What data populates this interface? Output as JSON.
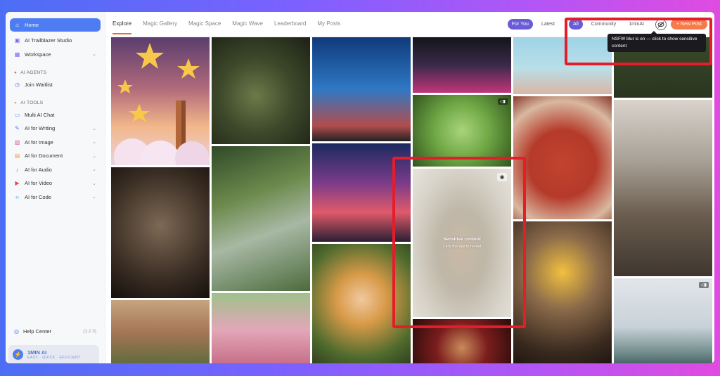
{
  "sidebar": {
    "items": [
      {
        "label": "Home",
        "icon": "home-icon",
        "glyph": "⌂"
      },
      {
        "label": "AI Trailblazer Studio",
        "icon": "studio-icon",
        "glyph": "▣"
      },
      {
        "label": "Workspace",
        "icon": "workspace-icon",
        "glyph": "▦"
      }
    ],
    "sections": {
      "agents": "AI AGENTS",
      "tools": "AI TOOLS"
    },
    "agent_items": [
      {
        "label": "Join Waitlist",
        "icon": "clock-icon",
        "glyph": "◷"
      }
    ],
    "tool_items": [
      {
        "label": "Multi AI Chat",
        "icon": "chat-icon",
        "glyph": "▭"
      },
      {
        "label": "AI for Writing",
        "icon": "writing-icon",
        "glyph": "✎"
      },
      {
        "label": "AI for Image",
        "icon": "image-icon",
        "glyph": "▨"
      },
      {
        "label": "AI for Document",
        "icon": "document-icon",
        "glyph": "▤"
      },
      {
        "label": "AI for Audio",
        "icon": "audio-icon",
        "glyph": "♪"
      },
      {
        "label": "AI for Video",
        "icon": "video-icon",
        "glyph": "▶"
      },
      {
        "label": "AI for Code",
        "icon": "code-icon",
        "glyph": "⟨⟩"
      }
    ],
    "help": {
      "label": "Help Center",
      "version": "(1.2.3)"
    },
    "brand": {
      "name": "1MIN AI",
      "tagline": "EASY · QUICK · EFFICIENT"
    }
  },
  "header": {
    "tabs": [
      "Explore",
      "Magic Gallery",
      "Magic Space",
      "Magic Wave",
      "Leaderboard",
      "My Posts"
    ],
    "active_tab": "Explore",
    "feed_toggle": [
      "For You",
      "Latest"
    ],
    "filter_toggle": [
      "All",
      "Community",
      "1minAI"
    ],
    "new_post": "+ New Post",
    "tooltip": "NSFW blur is on — click to show sensitive content"
  },
  "sensitive": {
    "title": "Sensitive content",
    "hint": "Click the eye to reveal"
  },
  "colors": {
    "accent": "#4d7cf3",
    "brand_orange": "#f57b4a",
    "purple": "#6a5bd6",
    "highlight": "#e31e2a"
  }
}
